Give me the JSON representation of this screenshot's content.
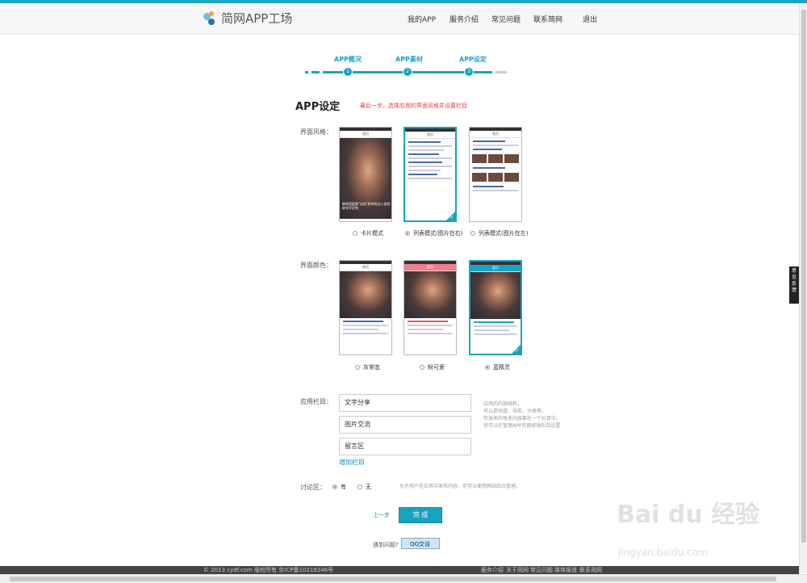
{
  "header": {
    "logo_text": "简网APP工场",
    "nav": [
      "我的APP",
      "服务介绍",
      "常见问题",
      "联系简网",
      "退出"
    ]
  },
  "steps": [
    "APP概况",
    "APP素材",
    "APP设定"
  ],
  "step_numbers": [
    "1",
    "2",
    "3"
  ],
  "page_title": "APP设定",
  "page_hint": "最后一步，选择应用的界面风格并设置栏目",
  "style_section": {
    "label": "界面风格：",
    "options": [
      {
        "label": "卡片模式",
        "selected": false
      },
      {
        "label": "列表模式(图片在右)",
        "selected": true
      },
      {
        "label": "列表模式(图片在左)",
        "selected": false
      }
    ],
    "card_caption": "换季搭配靠\"自信\"和你的达人类色穿衣不迟钝",
    "phone_bar": "首页"
  },
  "color_section": {
    "label": "界面颜色：",
    "options": [
      {
        "label": "灰常态",
        "selected": false,
        "color": "#555555"
      },
      {
        "label": "粉可爱",
        "selected": false,
        "color": "#f47b8a"
      },
      {
        "label": "蓝精灵",
        "selected": true,
        "color": "#1aa3c0"
      }
    ]
  },
  "columns_section": {
    "label": "应用栏目：",
    "fields": [
      "文字分享",
      "图片交流",
      "留言区"
    ],
    "add_link": "增加栏目",
    "notes": [
      "应用的内容结构，",
      "可以是频道、导航、分类等。",
      "你发表的每条内容都在一个栏目中。",
      "你可以在管理APP页面修改栏目设置"
    ]
  },
  "discussion": {
    "label": "讨论区：",
    "options": [
      {
        "label": "有",
        "selected": true
      },
      {
        "label": "无",
        "selected": false
      }
    ],
    "note": "允许用户在应用中发布内容，你可以使用网站后台管理。"
  },
  "actions": {
    "prev": "上一步",
    "done": "完 成"
  },
  "help": {
    "question": "遇到问题?",
    "qq": "QQ交谈"
  },
  "feedback": "意见反馈",
  "footer": {
    "copyright": "© 2013 cydf.com 版权所有 京ICP备10219246号",
    "links": [
      "服务介绍",
      "关于简网",
      "常见问题",
      "媒体报道",
      "联系简网"
    ]
  },
  "watermark": {
    "main": "Bai du 经验",
    "url": "jingyan.baidu.com"
  }
}
